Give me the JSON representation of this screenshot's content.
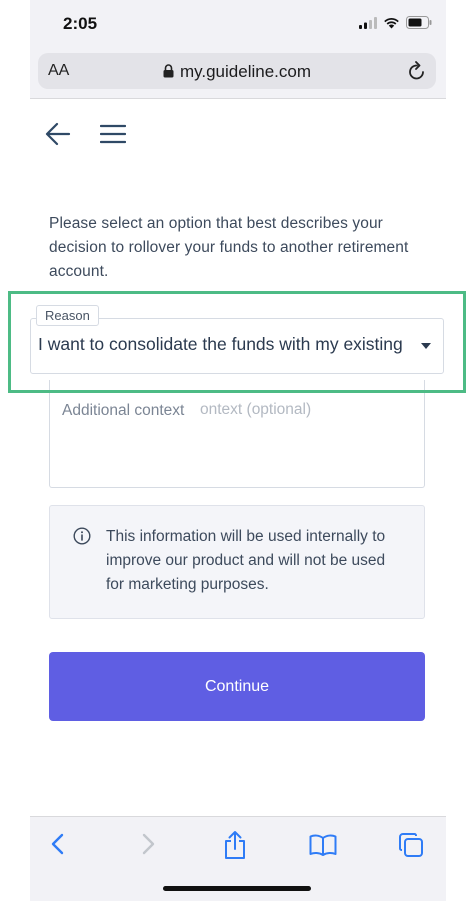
{
  "status_bar": {
    "time": "2:05"
  },
  "browser": {
    "text_size_button": "AA",
    "url": "my.guideline.com"
  },
  "page": {
    "description": "Please select an option that best describes your decision to rollover your funds to another retirement account.",
    "reason": {
      "label": "Reason",
      "value": "I want to consolidate the funds with my existing"
    },
    "context": {
      "label": "Additional context",
      "placeholder": "ontext (optional)"
    },
    "info_text": "This information will be used internally to improve our product and will not be used for marketing purposes.",
    "continue_label": "Continue"
  },
  "colors": {
    "accent": "#5f5ee3",
    "highlight": "#4dbb85",
    "ios_blue": "#2f7cf6"
  },
  "icons": [
    "signal-icon",
    "wifi-icon",
    "battery-icon",
    "lock-icon",
    "reload-icon",
    "back-arrow-icon",
    "hamburger-menu-icon",
    "info-icon",
    "chevron-left-icon",
    "chevron-right-icon",
    "share-icon",
    "bookmarks-icon",
    "tabs-icon"
  ]
}
